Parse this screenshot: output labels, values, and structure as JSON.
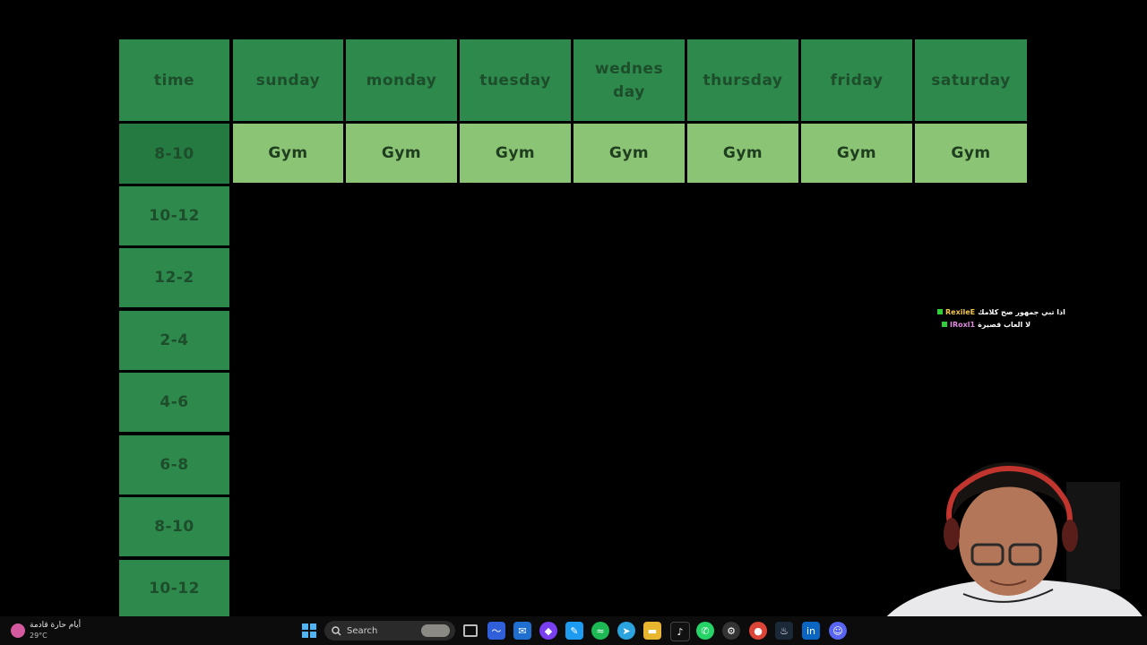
{
  "schedule": {
    "header": [
      "time",
      "sunday",
      "monday",
      "tuesday",
      "wednesday",
      "thursday",
      "friday",
      "saturday"
    ],
    "times": [
      "8-10",
      "10-12",
      "12-2",
      "2-4",
      "4-6",
      "6-8",
      "8-10",
      "10-12"
    ],
    "first_row_activities": [
      "Gym",
      "Gym",
      "Gym",
      "Gym",
      "Gym",
      "Gym",
      "Gym"
    ]
  },
  "chat": [
    {
      "user": "RexileE",
      "message": "اذا تبي جمهور صح كلامك"
    },
    {
      "user": "IRoxl1",
      "message": "لا العاب قصيرة"
    }
  ],
  "taskbar": {
    "weather_title": "أيام حارة قادمة",
    "weather_temp": "29°C",
    "search_placeholder": "Search"
  },
  "colors": {
    "header_green": "#2e8a4c",
    "active_time_green": "#257a42",
    "activity_green": "#8bc475",
    "background": "#000000"
  },
  "icons": [
    "windows-start-icon",
    "search-icon",
    "task-view-icon",
    "app-icon-1",
    "app-icon-2",
    "app-icon-3",
    "app-icon-4",
    "spotify-icon",
    "telegram-icon",
    "file-explorer-icon",
    "tiktok-icon",
    "whatsapp-icon",
    "app-icon-5",
    "chrome-icon",
    "steam-icon",
    "linkedin-icon",
    "discord-icon"
  ]
}
